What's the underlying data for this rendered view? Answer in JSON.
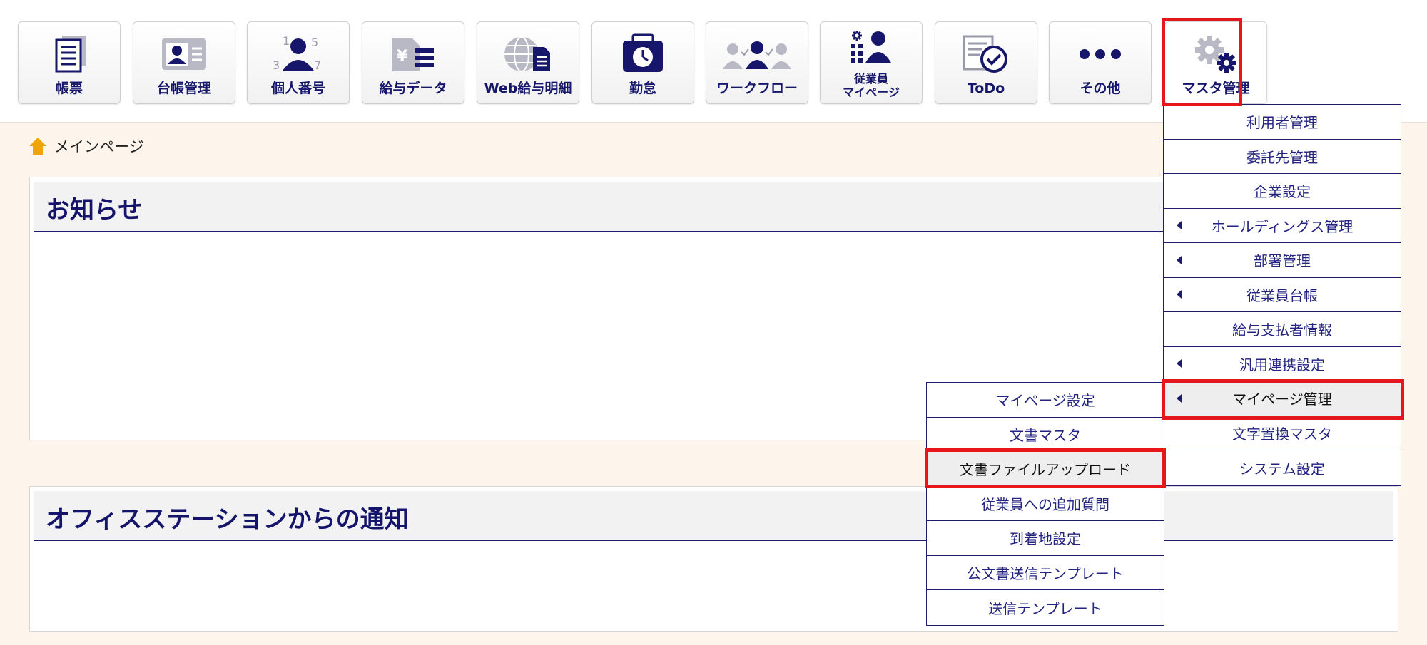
{
  "toolbar": {
    "buttons": [
      {
        "label": "帳票",
        "icon": "document-list-icon"
      },
      {
        "label": "台帳管理",
        "icon": "id-card-icon"
      },
      {
        "label": "個人番号",
        "icon": "person-number-icon"
      },
      {
        "label": "給与データ",
        "icon": "yen-list-icon"
      },
      {
        "label": "Web給与明細",
        "icon": "globe-document-icon"
      },
      {
        "label": "勤怠",
        "icon": "timecard-clock-icon"
      },
      {
        "label": "ワークフロー",
        "icon": "people-workflow-icon"
      },
      {
        "label_line1": "従業員",
        "label_line2": "マイページ",
        "icon": "employee-mypage-icon"
      },
      {
        "label": "ToDo",
        "icon": "todo-check-icon"
      },
      {
        "label": "その他",
        "icon": "more-dots-icon"
      },
      {
        "label": "マスタ管理",
        "icon": "gears-icon"
      }
    ]
  },
  "breadcrumb": {
    "home": "メインページ"
  },
  "panels": {
    "notice_title": "お知らせ",
    "office_title": "オフィスステーションからの通知"
  },
  "master_menu": {
    "items": [
      {
        "label": "利用者管理",
        "submenu": false
      },
      {
        "label": "委託先管理",
        "submenu": false
      },
      {
        "label": "企業設定",
        "submenu": false
      },
      {
        "label": "ホールディングス管理",
        "submenu": true
      },
      {
        "label": "部署管理",
        "submenu": true
      },
      {
        "label": "従業員台帳",
        "submenu": true
      },
      {
        "label": "給与支払者情報",
        "submenu": false
      },
      {
        "label": "汎用連携設定",
        "submenu": true
      },
      {
        "label": "マイページ管理",
        "submenu": true,
        "selected": true
      },
      {
        "label": "文字置換マスタ",
        "submenu": false
      },
      {
        "label": "システム設定",
        "submenu": false
      }
    ]
  },
  "mypage_menu": {
    "items": [
      {
        "label": "マイページ設定"
      },
      {
        "label": "文書マスタ"
      },
      {
        "label": "文書ファイルアップロード",
        "selected": true
      },
      {
        "label": "従業員への追加質問"
      },
      {
        "label": "到着地設定"
      },
      {
        "label": "公文書送信テンプレート"
      },
      {
        "label": "送信テンプレート"
      }
    ]
  },
  "colors": {
    "navy": "#1c1c6e",
    "highlight_red": "#e5161c",
    "background": "#fdf5ec",
    "home_icon": "#f0a30a"
  }
}
